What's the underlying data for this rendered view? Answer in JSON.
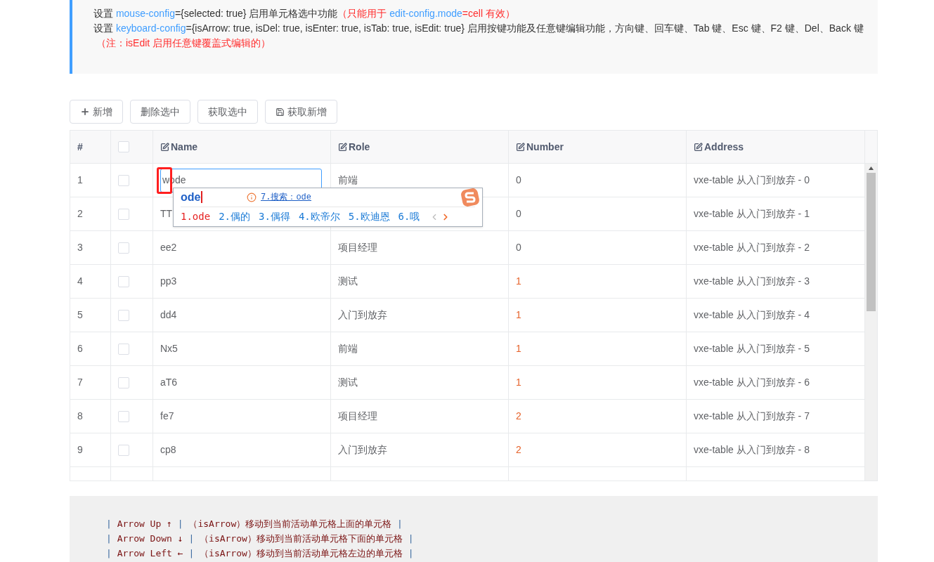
{
  "notes": [
    [
      {
        "kind": "plain",
        "text": "设置 "
      },
      {
        "kind": "link",
        "text": "mouse-config"
      },
      {
        "kind": "plain",
        "text": "={selected: true} 启用单元格选中功能"
      },
      {
        "kind": "warn",
        "text": "（只能用于 "
      },
      {
        "kind": "link",
        "text": "edit-config.mode"
      },
      {
        "kind": "warn",
        "text": "=cell 有效）"
      }
    ],
    [
      {
        "kind": "plain",
        "text": "设置 "
      },
      {
        "kind": "link",
        "text": "keyboard-config"
      },
      {
        "kind": "plain",
        "text": "={isArrow: true, isDel: true, isEnter: true, isTab: true, isEdit: true} 启用按键功能及任意键编辑功能，方向键、回车键、Tab 键、Esc 键、F2 键、Del、Back 键"
      }
    ],
    [
      {
        "kind": "warn",
        "text": "（注：isEdit 启用任意键覆盖式编辑的）"
      }
    ]
  ],
  "toolbar": [
    {
      "label": "新增",
      "kind": "add"
    },
    {
      "label": "删除选中",
      "kind": "plain"
    },
    {
      "label": "获取选中",
      "kind": "plain"
    },
    {
      "label": "获取新增",
      "kind": "save"
    }
  ],
  "table": {
    "header_checked": false,
    "columns": [
      {
        "label": "#",
        "kind": "plain"
      },
      {
        "kind": "checkbox"
      },
      {
        "label": "Name",
        "kind": "editable"
      },
      {
        "label": "Role",
        "kind": "editable"
      },
      {
        "label": "Number",
        "kind": "editable"
      },
      {
        "label": "Address",
        "kind": "editable"
      }
    ],
    "rows": [
      {
        "index": "1",
        "checked": false,
        "name": "wode",
        "editing": true,
        "role": "前端",
        "number": "0",
        "color": "#606266",
        "address": "vxe-table 从入门到放弃 - 0"
      },
      {
        "index": "2",
        "checked": false,
        "name": "TT",
        "editing": false,
        "role": "",
        "number": "0",
        "color": "#606266",
        "address": "vxe-table 从入门到放弃 - 1"
      },
      {
        "index": "3",
        "checked": false,
        "name": "ee2",
        "editing": false,
        "role": "项目经理",
        "number": "0",
        "color": "#606266",
        "address": "vxe-table 从入门到放弃 - 2"
      },
      {
        "index": "4",
        "checked": false,
        "name": "pp3",
        "editing": false,
        "role": "测试",
        "number": "1",
        "color": "#e6632b",
        "address": "vxe-table 从入门到放弃 - 3"
      },
      {
        "index": "5",
        "checked": false,
        "name": "dd4",
        "editing": false,
        "role": "入门到放弃",
        "number": "1",
        "color": "#e6632b",
        "address": "vxe-table 从入门到放弃 - 4"
      },
      {
        "index": "6",
        "checked": false,
        "name": "Nx5",
        "editing": false,
        "role": "前端",
        "number": "1",
        "color": "#e6632b",
        "address": "vxe-table 从入门到放弃 - 5"
      },
      {
        "index": "7",
        "checked": false,
        "name": "aT6",
        "editing": false,
        "role": "测试",
        "number": "1",
        "color": "#e6632b",
        "address": "vxe-table 从入门到放弃 - 6"
      },
      {
        "index": "8",
        "checked": false,
        "name": "fe7",
        "editing": false,
        "role": "项目经理",
        "number": "2",
        "color": "#e6632b",
        "address": "vxe-table 从入门到放弃 - 7"
      },
      {
        "index": "9",
        "checked": false,
        "name": "cp8",
        "editing": false,
        "role": "入门到放弃",
        "number": "2",
        "color": "#e6632b",
        "address": "vxe-table 从入门到放弃 - 8"
      }
    ]
  },
  "ime": {
    "composition": "ode",
    "search": "7.搜索：ode",
    "candidates": [
      {
        "text": "1.ode",
        "selected": true
      },
      {
        "text": "2.偶的",
        "selected": false
      },
      {
        "text": "3.偶得",
        "selected": false
      },
      {
        "text": "4.欧帝尔",
        "selected": false
      },
      {
        "text": "5.欧迪恩",
        "selected": false
      },
      {
        "text": "6.哦",
        "selected": false
      }
    ]
  },
  "doc_lines": [
    {
      "key": "Arrow Up ↑",
      "desc": "（isArrow）移动到当前活动单元格上面的单元格"
    },
    {
      "key": "Arrow Down ↓",
      "desc": "（isArrow）移动到当前活动单元格下面的单元格"
    },
    {
      "key": "Arrow Left ←",
      "desc": "（isArrow）移动到当前活动单元格左边的单元格"
    }
  ],
  "doc_pipe": "|"
}
